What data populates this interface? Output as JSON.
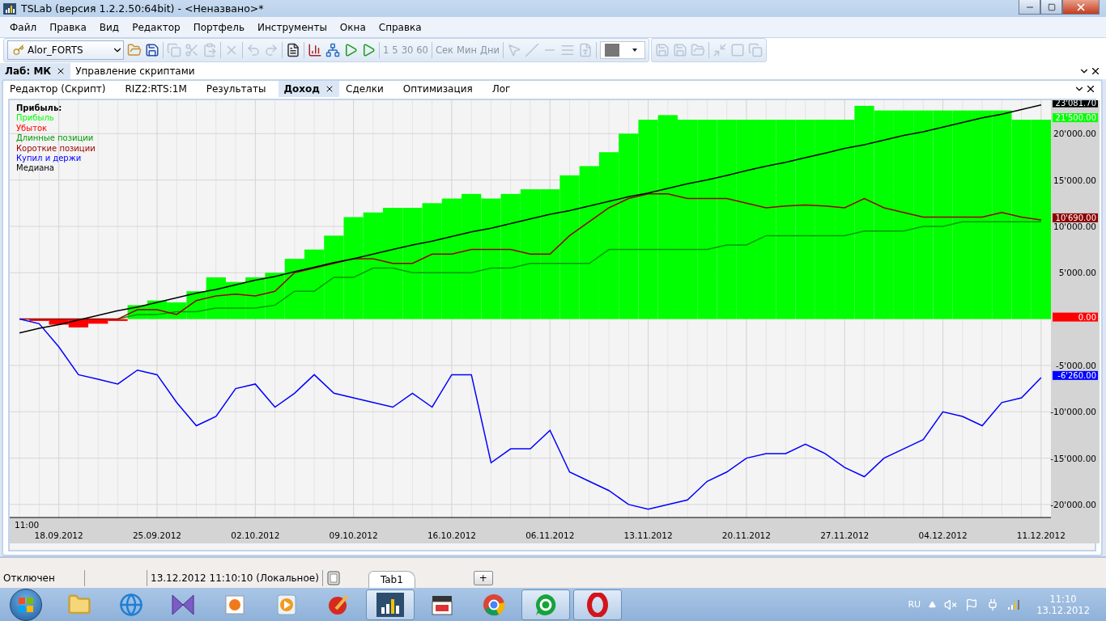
{
  "window": {
    "title": "TSLab (версия 1.2.2.50:64bit) - <Неназвано>*"
  },
  "menu": [
    "Файл",
    "Правка",
    "Вид",
    "Редактор",
    "Портфель",
    "Инструменты",
    "Окна",
    "Справка"
  ],
  "toolbar": {
    "account": "Alor_FORTS",
    "intervals": [
      "1",
      "5",
      "30",
      "60"
    ],
    "units": [
      "Сек",
      "Мин",
      "Дни"
    ]
  },
  "doc_tabs": [
    {
      "label": "Лаб: МК",
      "selected": true
    },
    {
      "label": "Управление скриптами",
      "selected": false
    }
  ],
  "view_tabs": [
    {
      "label": "Редактор (Скрипт)",
      "selected": false
    },
    {
      "label": "RIZ2:RTS:1M",
      "selected": false
    },
    {
      "label": "Результаты",
      "selected": false
    },
    {
      "label": "Доход",
      "selected": true
    },
    {
      "label": "Сделки",
      "selected": false
    },
    {
      "label": "Оптимизация",
      "selected": false
    },
    {
      "label": "Лог",
      "selected": false
    }
  ],
  "chart": {
    "legend_title": "Прибыль:",
    "time_label": "11:00",
    "chart_data": {
      "type": "line",
      "grid": true,
      "categories": [
        null,
        null,
        "18.09.2012",
        null,
        null,
        null,
        null,
        "25.09.2012",
        null,
        null,
        null,
        null,
        "02.10.2012",
        null,
        null,
        null,
        null,
        "09.10.2012",
        null,
        null,
        null,
        null,
        "16.10.2012",
        null,
        null,
        null,
        null,
        "06.11.2012",
        null,
        null,
        null,
        null,
        "13.11.2012",
        null,
        null,
        null,
        null,
        "20.11.2012",
        null,
        null,
        null,
        null,
        "27.11.2012",
        null,
        null,
        null,
        null,
        "04.12.2012",
        null,
        null,
        null,
        null,
        "11.12.2012"
      ],
      "ylim": [
        -21400,
        23600
      ],
      "yticks": [
        {
          "value": 20000,
          "label": "20'000.00"
        },
        {
          "value": 15000,
          "label": "15'000.00"
        },
        {
          "value": 10000,
          "label": "10'000.00"
        },
        {
          "value": 5000,
          "label": "5'000.00"
        },
        {
          "value": -5000,
          "label": "-5'000.00"
        },
        {
          "value": -10000,
          "label": "-10'000.00"
        },
        {
          "value": -15000,
          "label": "-15'000.00"
        },
        {
          "value": -20000,
          "label": "-20'000.00"
        }
      ],
      "series": [
        {
          "name": "Прибыль",
          "color": "#00ff00",
          "type": "bar",
          "values": [
            0,
            0,
            0,
            0,
            0,
            0,
            1500,
            2000,
            1800,
            3000,
            4500,
            4000,
            4500,
            5000,
            6500,
            7500,
            9000,
            11000,
            11500,
            12000,
            12000,
            12500,
            13000,
            13500,
            13000,
            13500,
            14000,
            14000,
            15500,
            16500,
            18000,
            20000,
            21500,
            22000,
            21500,
            21500,
            21500,
            21500,
            21500,
            21500,
            21500,
            21500,
            21500,
            23000,
            22500,
            22500,
            22500,
            22500,
            22500,
            22500,
            22500,
            21500,
            21500
          ]
        },
        {
          "name": "Убыток",
          "color": "#ff0000",
          "type": "bar",
          "values": [
            null,
            -200,
            -600,
            -900,
            -500,
            -200,
            null,
            null,
            null,
            null,
            null,
            null,
            null,
            null,
            null,
            null,
            null,
            null,
            null,
            null,
            null,
            null,
            null,
            null,
            null,
            null,
            null,
            null,
            null,
            null,
            null,
            null,
            null,
            null,
            null,
            null,
            null,
            null,
            null,
            null,
            null,
            null,
            null,
            null,
            null,
            null,
            null,
            null,
            null,
            null,
            null,
            null,
            null
          ]
        },
        {
          "name": "Длинные позиции",
          "color": "#009900",
          "values": [
            null,
            null,
            null,
            null,
            null,
            0,
            500,
            500,
            800,
            800,
            1200,
            1200,
            1200,
            1500,
            3000,
            3000,
            4500,
            4500,
            5500,
            5500,
            5000,
            5000,
            5000,
            5000,
            5500,
            5500,
            6000,
            6000,
            6000,
            6000,
            7500,
            7500,
            7500,
            7500,
            7500,
            7500,
            8000,
            8000,
            9000,
            9000,
            9000,
            9000,
            9000,
            9500,
            9500,
            9500,
            10000,
            10000,
            10500,
            10500,
            10500,
            10500,
            10500
          ]
        },
        {
          "name": "Короткие позиции",
          "color": "#990000",
          "values": [
            0,
            0,
            0,
            0,
            0,
            0,
            1000,
            1000,
            500,
            2000,
            2500,
            2700,
            2500,
            3000,
            5000,
            5500,
            6000,
            6500,
            6500,
            6000,
            6000,
            7000,
            7000,
            7500,
            7500,
            7500,
            7000,
            7000,
            9000,
            10500,
            12000,
            13000,
            13500,
            13500,
            13000,
            13000,
            13000,
            12500,
            12000,
            12200,
            12300,
            12200,
            12000,
            13000,
            12000,
            11500,
            11000,
            11000,
            11000,
            11000,
            11500,
            11000,
            10700
          ]
        },
        {
          "name": "Купил и держи",
          "color": "#0000ff",
          "values": [
            0,
            -500,
            -3000,
            -6000,
            -6500,
            -7000,
            -5500,
            -6000,
            -9000,
            -11500,
            -10500,
            -7500,
            -7000,
            -9500,
            -8000,
            -6000,
            -8000,
            -8500,
            -9000,
            -9500,
            -8000,
            -9500,
            -6000,
            -6000,
            -15500,
            -14000,
            -14000,
            -12000,
            -16500,
            -17500,
            -18500,
            -20000,
            -20500,
            -20000,
            -19500,
            -17500,
            -16500,
            -15000,
            -14500,
            -14500,
            -13500,
            -14500,
            -16000,
            -17000,
            -15000,
            -14000,
            -13000,
            -10000,
            -10500,
            -11500,
            -9000,
            -8500,
            -6300
          ]
        },
        {
          "name": "Медиана",
          "color": "#000000",
          "values": [
            -1500,
            -1000,
            -600,
            -100,
            400,
            900,
            1300,
            1800,
            2300,
            2800,
            3200,
            3700,
            4200,
            4600,
            5100,
            5600,
            6100,
            6500,
            7000,
            7500,
            8000,
            8400,
            8900,
            9400,
            9800,
            10300,
            10800,
            11300,
            11700,
            12200,
            12700,
            13200,
            13600,
            14100,
            14600,
            15000,
            15500,
            16000,
            16500,
            16900,
            17400,
            17900,
            18400,
            18800,
            19300,
            19800,
            20200,
            20700,
            21200,
            21700,
            22100,
            22600,
            23100
          ]
        }
      ],
      "annotations": [
        "23'081.70",
        "21'500.00",
        "10'690.00",
        "0.00",
        "-6'260.00"
      ]
    },
    "value_tags": [
      {
        "color": "#000000"
      },
      {
        "color": "#00ff00"
      },
      {
        "color": "#8b0000"
      },
      {
        "color": "#ff0000"
      },
      {
        "color": "#0000ff"
      }
    ]
  },
  "status_bar": {
    "connection": "Отключен",
    "time": "13.12.2012 11:10:10 (Локальное)",
    "tabs": [
      {
        "label": "Tab1",
        "selected": true
      }
    ],
    "add_label": "+"
  },
  "taskbar": {
    "apps": [
      {
        "kind": "folder",
        "active": false
      },
      {
        "kind": "browser",
        "active": false
      },
      {
        "kind": "bowtie",
        "active": false
      },
      {
        "kind": "photo",
        "active": false
      },
      {
        "kind": "media",
        "active": false
      },
      {
        "kind": "cleaner",
        "active": false
      },
      {
        "kind": "chart",
        "active": true
      },
      {
        "kind": "film",
        "active": false
      },
      {
        "kind": "chrome",
        "active": false
      },
      {
        "kind": "mail",
        "active": true
      },
      {
        "kind": "opera",
        "active": true
      }
    ],
    "language": "RU",
    "clock": "11:10",
    "date": "13.12.2012"
  }
}
